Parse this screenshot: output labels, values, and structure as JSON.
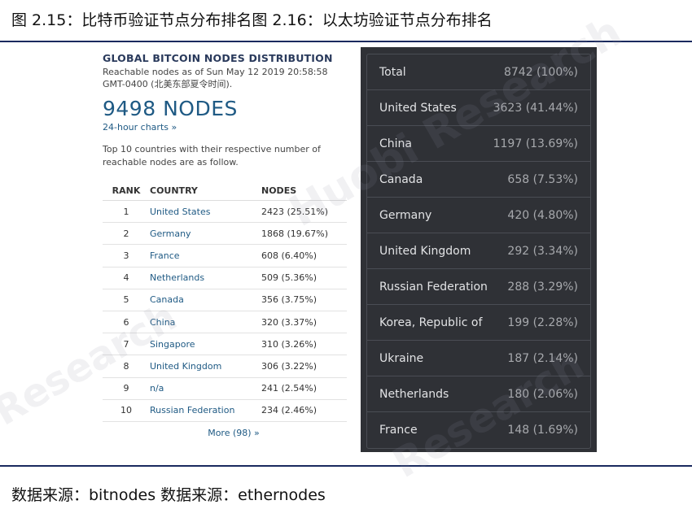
{
  "header": {
    "caption": "图 2.15：比特币验证节点分布排名图 2.16：以太坊验证节点分布排名"
  },
  "footer": {
    "source": "数据来源：bitnodes 数据来源：ethernodes"
  },
  "watermark": {
    "text1": "Huobi Research",
    "text2": "Research",
    "text3": "Research"
  },
  "bitnodes": {
    "title": "GLOBAL BITCOIN NODES DISTRIBUTION",
    "subtitle": "Reachable nodes as of Sun May 12 2019 20:58:58 GMT-0400 (北美东部夏令时间).",
    "count": "9498 NODES",
    "charts_link": "24-hour charts »",
    "intro": "Top 10 countries with their respective number of reachable nodes are as follow.",
    "columns": {
      "rank": "RANK",
      "country": "COUNTRY",
      "nodes": "NODES"
    },
    "rows": [
      {
        "rank": "1",
        "country": "United States",
        "nodes": "2423 (25.51%)"
      },
      {
        "rank": "2",
        "country": "Germany",
        "nodes": "1868 (19.67%)"
      },
      {
        "rank": "3",
        "country": "France",
        "nodes": "608 (6.40%)"
      },
      {
        "rank": "4",
        "country": "Netherlands",
        "nodes": "509 (5.36%)"
      },
      {
        "rank": "5",
        "country": "Canada",
        "nodes": "356 (3.75%)"
      },
      {
        "rank": "6",
        "country": "China",
        "nodes": "320 (3.37%)"
      },
      {
        "rank": "7",
        "country": "Singapore",
        "nodes": "310 (3.26%)"
      },
      {
        "rank": "8",
        "country": "United Kingdom",
        "nodes": "306 (3.22%)"
      },
      {
        "rank": "9",
        "country": "n/a",
        "nodes": "241 (2.54%)"
      },
      {
        "rank": "10",
        "country": "Russian Federation",
        "nodes": "234 (2.46%)"
      }
    ],
    "more_link": "More (98) »"
  },
  "ethernodes": {
    "rows": [
      {
        "name": "Total",
        "value": "8742 (100%)"
      },
      {
        "name": "United States",
        "value": "3623 (41.44%)"
      },
      {
        "name": "China",
        "value": "1197 (13.69%)"
      },
      {
        "name": "Canada",
        "value": "658 (7.53%)"
      },
      {
        "name": "Germany",
        "value": "420 (4.80%)"
      },
      {
        "name": "United Kingdom",
        "value": "292 (3.34%)"
      },
      {
        "name": "Russian Federation",
        "value": "288 (3.29%)"
      },
      {
        "name": "Korea, Republic of",
        "value": "199 (2.28%)"
      },
      {
        "name": "Ukraine",
        "value": "187 (2.14%)"
      },
      {
        "name": "Netherlands",
        "value": "180 (2.06%)"
      },
      {
        "name": "France",
        "value": "148 (1.69%)"
      }
    ]
  }
}
